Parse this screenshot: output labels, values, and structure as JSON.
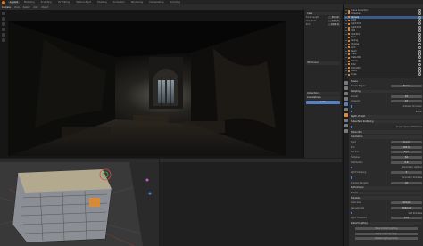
{
  "app": {
    "name": "Blender"
  },
  "workspace_tabs": [
    {
      "label": "Layout",
      "active": true
    },
    {
      "label": "Modeling",
      "active": false
    },
    {
      "label": "Sculpting",
      "active": false
    },
    {
      "label": "UV Editing",
      "active": false
    },
    {
      "label": "Texture Paint",
      "active": false
    },
    {
      "label": "Shading",
      "active": false
    },
    {
      "label": "Animation",
      "active": false
    },
    {
      "label": "Rendering",
      "active": false
    },
    {
      "label": "Compositing",
      "active": false
    },
    {
      "label": "Scripting",
      "active": false
    }
  ],
  "editor_toolbar": {
    "items": [
      {
        "label": "Camera",
        "active": true
      },
      {
        "label": "View",
        "active": false
      },
      {
        "label": "Select",
        "active": false
      },
      {
        "label": "Add",
        "active": false
      },
      {
        "label": "Object",
        "active": false
      }
    ]
  },
  "npanel": {
    "section1_title": "View",
    "rows": [
      {
        "label": "Focal Length",
        "value": "50 mm"
      },
      {
        "label": "Clip Start",
        "value": "0.01 m"
      },
      {
        "label": "End",
        "value": "1000 m"
      }
    ],
    "section2_title": "3D Cursor",
    "section3_title": "Collections",
    "section4_title": "Annotations",
    "button_label": "Lock"
  },
  "outliner": {
    "items": [
      {
        "name": "Scene Collection",
        "selected": false
      },
      {
        "name": "Collection",
        "selected": false
      },
      {
        "name": "Camera",
        "selected": true
      },
      {
        "name": "Light",
        "selected": false
      },
      {
        "name": "Light.001",
        "selected": false
      },
      {
        "name": "Light.002",
        "selected": false
      },
      {
        "name": "Wall",
        "selected": false
      },
      {
        "name": "Wall.001",
        "selected": false
      },
      {
        "name": "Floor",
        "selected": false
      },
      {
        "name": "Ceiling",
        "selected": false
      },
      {
        "name": "Window",
        "selected": false
      },
      {
        "name": "Arch",
        "selected": false
      },
      {
        "name": "Beam",
        "selected": false
      },
      {
        "name": "Crate",
        "selected": false
      },
      {
        "name": "Crate.001",
        "selected": false
      },
      {
        "name": "Debris",
        "selected": false
      },
      {
        "name": "Pillar",
        "selected": false
      },
      {
        "name": "Pillar.001",
        "selected": false
      },
      {
        "name": "Stairs",
        "selected": false
      },
      {
        "name": "Props",
        "selected": false
      }
    ]
  },
  "properties": {
    "title": "Scene",
    "rows": [
      {
        "label": "Render Engine",
        "value": "Eevee",
        "type": "field"
      },
      {
        "label": "Sampling",
        "type": "section"
      },
      {
        "label": "Render",
        "value": "64",
        "type": "field"
      },
      {
        "label": "Viewport",
        "value": "16",
        "type": "field"
      },
      {
        "label": "Ambient Occlusion",
        "type": "check"
      },
      {
        "label": "Bloom",
        "type": "check"
      },
      {
        "label": "Depth of Field",
        "type": "section"
      },
      {
        "label": "Subsurface Scattering",
        "type": "section"
      },
      {
        "label": "Screen Space Reflections",
        "type": "check"
      },
      {
        "label": "Motion Blur",
        "type": "section"
      },
      {
        "label": "Volumetrics",
        "type": "section"
      },
      {
        "label": "Start",
        "value": "0.1 m",
        "type": "field"
      },
      {
        "label": "End",
        "value": "100 m",
        "type": "field"
      },
      {
        "label": "Tile Size",
        "value": "8 px",
        "type": "field"
      },
      {
        "label": "Samples",
        "value": "64",
        "type": "field"
      },
      {
        "label": "Distribution",
        "value": "0.8",
        "type": "field"
      },
      {
        "label": "Volumetric Lighting",
        "type": "check"
      },
      {
        "label": "Light Clamping",
        "value": "0",
        "type": "field"
      },
      {
        "label": "Volumetric Shadows",
        "type": "check"
      },
      {
        "label": "Shadow Samples",
        "value": "16",
        "type": "field"
      },
      {
        "label": "Performance",
        "type": "section"
      },
      {
        "label": "Curves",
        "type": "section"
      },
      {
        "label": "Shadows",
        "type": "section"
      },
      {
        "label": "Cube Size",
        "value": "512 px",
        "type": "field"
      },
      {
        "label": "Cascade Size",
        "value": "1024 px",
        "type": "field"
      },
      {
        "label": "Soft Shadows",
        "type": "check"
      },
      {
        "label": "Light Threshold",
        "value": "0.01",
        "type": "field"
      },
      {
        "label": "Indirect Lighting",
        "type": "section"
      },
      {
        "label": "Bake Indirect Lighting",
        "type": "button"
      },
      {
        "label": "Bake Cubemap Only",
        "type": "button"
      },
      {
        "label": "Delete Lighting Cache",
        "type": "button"
      }
    ]
  },
  "colors": {
    "accent_blue": "#5680c2",
    "selected_row": "#3c5a8a",
    "object_orange": "#e28a3c",
    "logo_orange": "#e87d0d"
  }
}
